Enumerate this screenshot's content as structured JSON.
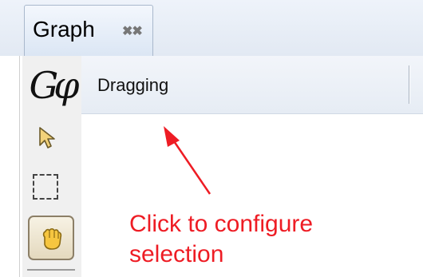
{
  "tabs": [
    {
      "label": "Graph",
      "close_icon": "close-icon"
    }
  ],
  "toolbar": {
    "logo_text": "Gφ",
    "tools": [
      {
        "name": "select-pointer",
        "icon": "pointer-arrow-icon"
      },
      {
        "name": "rectangle-selection",
        "icon": "dashed-rectangle-icon"
      },
      {
        "name": "drag",
        "icon": "hand-icon",
        "selected": true
      }
    ]
  },
  "header": {
    "mode_label": "Dragging"
  },
  "annotation": {
    "text_line1": "Click to configure",
    "text_line2": "selection",
    "color": "#ee1c24"
  }
}
